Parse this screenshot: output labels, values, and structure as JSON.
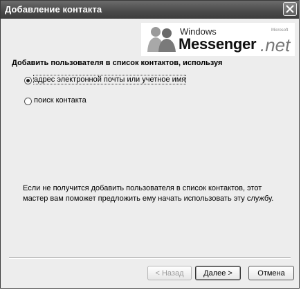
{
  "window": {
    "title": "Добавление контакта"
  },
  "logo": {
    "brand_small": "Windows",
    "brand_big": "Messenger",
    "suffix": ".net",
    "tagline": "Microsoft"
  },
  "heading": "Добавить пользователя в список контактов, используя",
  "options": [
    {
      "label": "адрес электронной почты или учетное имя",
      "selected": true
    },
    {
      "label": "поиск контакта",
      "selected": false
    }
  ],
  "info_text": "Если не получится добавить пользователя в список контактов, этот мастер вам поможет предложить ему начать использовать эту службу.",
  "buttons": {
    "back": "< Назад",
    "next": "Далее >",
    "cancel": "Отмена"
  }
}
